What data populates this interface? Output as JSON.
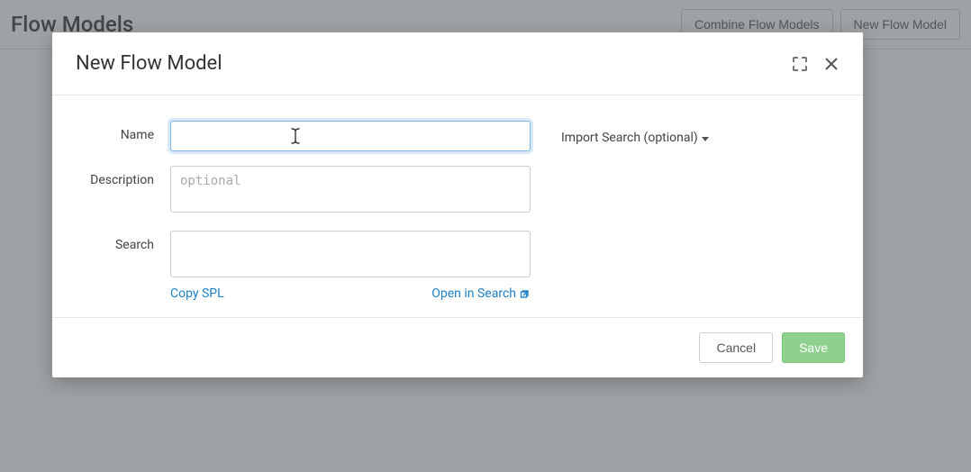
{
  "page": {
    "title": "Flow Models",
    "buttons": {
      "combine": "Combine Flow Models",
      "new": "New Flow Model"
    }
  },
  "modal": {
    "title": "New Flow Model",
    "form": {
      "name_label": "Name",
      "name_value": "",
      "description_label": "Description",
      "description_value": "",
      "description_placeholder": "optional",
      "search_label": "Search",
      "search_value": "",
      "copy_spl": "Copy SPL",
      "open_in_search": "Open in Search"
    },
    "import": {
      "label": "Import Search (optional)"
    },
    "footer": {
      "cancel": "Cancel",
      "save": "Save"
    }
  }
}
